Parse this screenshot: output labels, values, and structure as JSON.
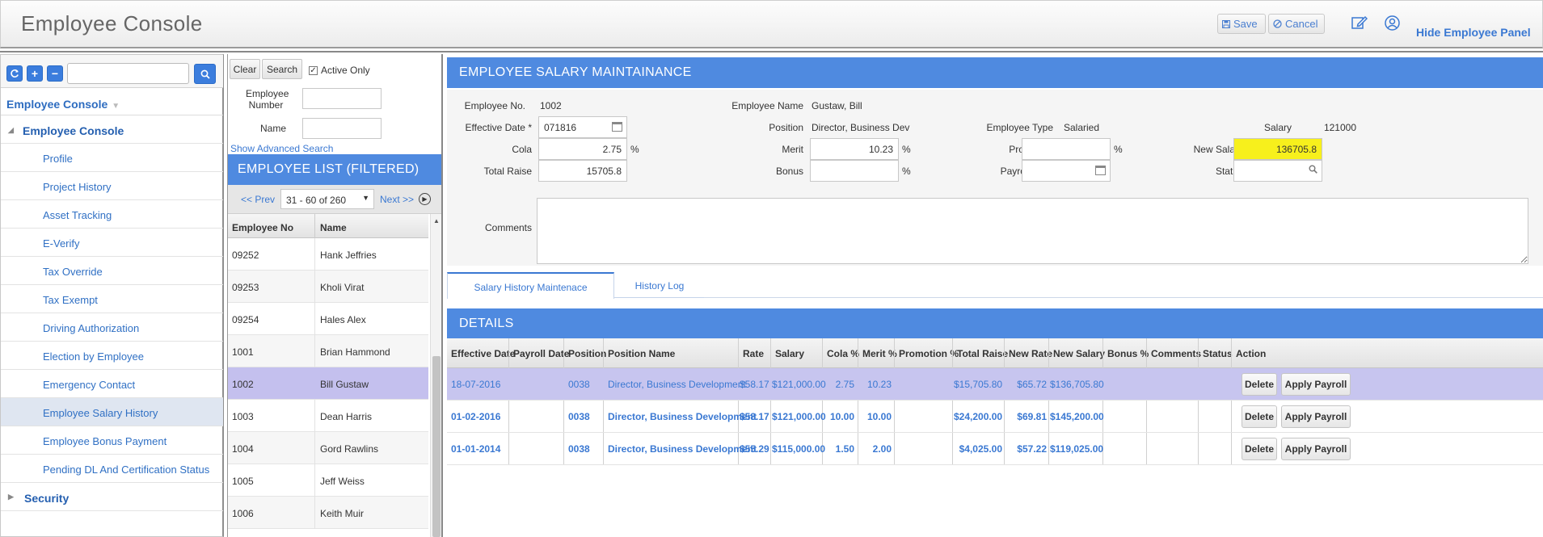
{
  "header": {
    "title": "Employee Console",
    "save_label": "Save",
    "cancel_label": "Cancel",
    "hide_panel_label": "Hide Employee Panel",
    "edit_icon": "edit-icon",
    "user_icon": "user-icon"
  },
  "sidebar": {
    "header_label": "Employee Console",
    "root_label": "Employee Console",
    "items": [
      {
        "label": "Profile"
      },
      {
        "label": "Project History"
      },
      {
        "label": "Asset Tracking"
      },
      {
        "label": "E-Verify"
      },
      {
        "label": "Tax Override"
      },
      {
        "label": "Tax Exempt"
      },
      {
        "label": "Driving Authorization"
      },
      {
        "label": "Election by Employee"
      },
      {
        "label": "Emergency Contact"
      },
      {
        "label": "Employee Salary History"
      },
      {
        "label": "Employee Bonus Payment"
      },
      {
        "label": "Pending DL And Certification Status"
      }
    ],
    "security_label": "Security",
    "search_placeholder": ""
  },
  "employee_list": {
    "clear_label": "Clear",
    "search_label": "Search",
    "active_only_label": "Active Only",
    "employee_number_label": "Employee Number",
    "name_label": "Name",
    "advanced_search_label": "Show Advanced Search",
    "title": "EMPLOYEE LIST (FILTERED)",
    "prev_label": "<< Prev",
    "page_selection": "31 - 60 of 260",
    "next_label": "Next >>",
    "columns": [
      "Employee No",
      "Name"
    ],
    "rows": [
      [
        "09252",
        "Hank Jeffries"
      ],
      [
        "09253",
        "Kholi Virat"
      ],
      [
        "09254",
        "Hales Alex"
      ],
      [
        "1001",
        "Brian Hammond"
      ],
      [
        "1002",
        "Bill Gustaw"
      ],
      [
        "1003",
        "Dean Harris"
      ],
      [
        "1004",
        "Gord Rawlins"
      ],
      [
        "1005",
        "Jeff Weiss"
      ],
      [
        "1006",
        "Keith Muir"
      ]
    ]
  },
  "salary_form": {
    "title": "EMPLOYEE SALARY MAINTAINANCE",
    "employee_no_label": "Employee No.",
    "employee_no": "1002",
    "employee_name_label": "Employee Name",
    "employee_name": "Gustaw, Bill",
    "effective_date_label": "Effective Date *",
    "effective_date": "071816",
    "position_label": "Position",
    "position": "Director, Business Dev",
    "employee_type_label": "Employee Type",
    "employee_type": "Salaried",
    "salary_label": "Salary",
    "salary": "121000",
    "cola_label": "Cola",
    "cola": "2.75",
    "merit_label": "Merit",
    "merit": "10.23",
    "promotion_label": "Promotion",
    "promotion": "",
    "new_salary_label": "New Salary",
    "new_salary": "136705.8",
    "total_raise_label": "Total Raise",
    "total_raise": "15705.8",
    "bonus_label": "Bonus",
    "bonus": "",
    "payroll_date_label": "Payroll Date",
    "payroll_date": "",
    "status_label": "Status",
    "status": "",
    "comments_label": "Comments",
    "comments": "",
    "percent": "%"
  },
  "tabs": [
    {
      "label": "Salary History Maintenace"
    },
    {
      "label": "History Log"
    }
  ],
  "details": {
    "title": "DETAILS",
    "columns": [
      "Effective Date",
      "Payroll Date",
      "Position",
      "Position Name",
      "Rate",
      "Salary",
      "Cola %",
      "Merit %",
      "Promotion %",
      "Total Raise",
      "New Rate",
      "New Salary",
      "Bonus %",
      "Comments",
      "Status",
      "Action"
    ],
    "delete_label": "Delete",
    "apply_label": "Apply Payroll",
    "rows": [
      {
        "effective_date": "18-07-2016",
        "payroll_date": "",
        "position": "0038",
        "position_name": "Director, Business Development",
        "rate": "$58.17",
        "salary": "$121,000.00",
        "cola": "2.75",
        "merit": "10.23",
        "promotion": "",
        "total_raise": "$15,705.80",
        "new_rate": "$65.72",
        "new_salary": "$136,705.80",
        "bonus": "",
        "comments": "",
        "status": ""
      },
      {
        "effective_date": "01-02-2016",
        "payroll_date": "",
        "position": "0038",
        "position_name": "Director, Business Development",
        "rate": "$58.17",
        "salary": "$121,000.00",
        "cola": "10.00",
        "merit": "10.00",
        "promotion": "",
        "total_raise": "$24,200.00",
        "new_rate": "$69.81",
        "new_salary": "$145,200.00",
        "bonus": "",
        "comments": "",
        "status": ""
      },
      {
        "effective_date": "01-01-2014",
        "payroll_date": "",
        "position": "0038",
        "position_name": "Director, Business Development",
        "rate": "$55.29",
        "salary": "$115,000.00",
        "cola": "1.50",
        "merit": "2.00",
        "promotion": "",
        "total_raise": "$4,025.00",
        "new_rate": "$57.22",
        "new_salary": "$119,025.00",
        "bonus": "",
        "comments": "",
        "status": ""
      }
    ]
  }
}
